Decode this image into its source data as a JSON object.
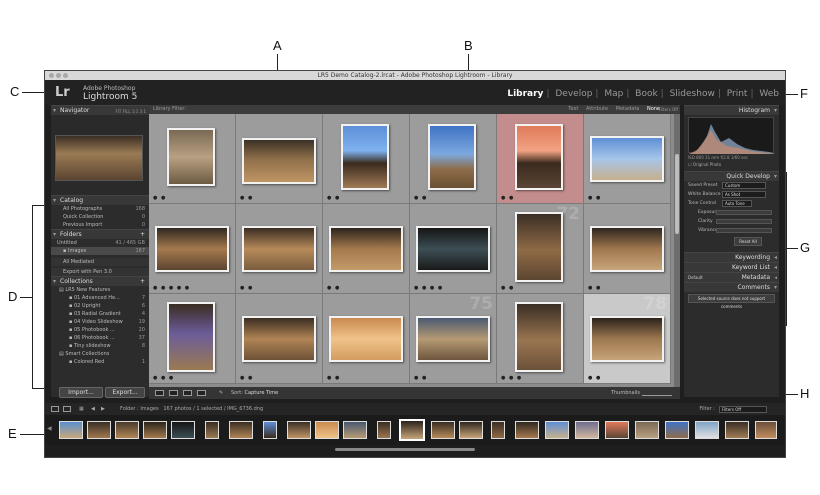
{
  "window": {
    "title": "LR5 Demo Catalog-2.lrcat - Adobe Photoshop Lightroom - Library"
  },
  "identity": {
    "logo": "Lr",
    "product": "Adobe Photoshop",
    "version": "Lightroom 5"
  },
  "modules": [
    "Library",
    "Develop",
    "Map",
    "Book",
    "Slideshow",
    "Print",
    "Web"
  ],
  "active_module": "Library",
  "callouts": {
    "A": "A",
    "B": "B",
    "C": "C",
    "D": "D",
    "E": "E",
    "F": "F",
    "G": "G",
    "H": "H"
  },
  "left_panel": {
    "navigator": {
      "title": "Navigator",
      "zoom": "FIT  FILL  1:1  3:1"
    },
    "catalog": {
      "title": "Catalog",
      "items": [
        {
          "label": "All Photographs",
          "count": "168"
        },
        {
          "label": "Quick Collection",
          "count": "0"
        },
        {
          "label": "Previous Import",
          "count": "0"
        }
      ]
    },
    "folders": {
      "title": "Folders",
      "volume": {
        "label": "Untitled",
        "count": "41 / 465 GB"
      },
      "items": [
        {
          "label": "Images",
          "count": "167"
        }
      ]
    },
    "sub_panels": [
      "All Mediated",
      "Export with Pen 3.0"
    ],
    "collections": {
      "title": "Collections",
      "items": [
        {
          "label": "LR5 New Features",
          "count": ""
        },
        {
          "label": "01 Advanced He...",
          "count": "7"
        },
        {
          "label": "02 Upright",
          "count": "6"
        },
        {
          "label": "03 Radial Gradient",
          "count": "4"
        },
        {
          "label": "04 Video Slideshow",
          "count": "19"
        },
        {
          "label": "05 Photobook ...",
          "count": "20"
        },
        {
          "label": "06 Photobook ...",
          "count": "37"
        },
        {
          "label": "Tiny slideshow",
          "count": "8"
        },
        {
          "label": "Smart Collections",
          "count": ""
        },
        {
          "label": "Colored Red",
          "count": "1"
        }
      ]
    },
    "import_label": "Import...",
    "export_label": "Export..."
  },
  "center": {
    "filter_title": "Library Filter:",
    "filter_options": [
      "Text",
      "Attribute",
      "Metadata",
      "None"
    ],
    "filter_active": "None",
    "filter_status": "Filters Off",
    "cells": [
      {
        "num": "",
        "stars": "● ●"
      },
      {
        "num": "",
        "stars": "● ●"
      },
      {
        "num": "",
        "stars": "● ●"
      },
      {
        "num": "",
        "stars": "● ●"
      },
      {
        "num": "",
        "stars": "● ●"
      },
      {
        "num": "",
        "stars": "● ●"
      },
      {
        "num": "",
        "stars": "● ● ● ● ●"
      },
      {
        "num": "",
        "stars": "● ●"
      },
      {
        "num": "",
        "stars": "● ●"
      },
      {
        "num": "",
        "stars": "● ● ● ●"
      },
      {
        "num": "72",
        "stars": "● ●"
      },
      {
        "num": "",
        "stars": "● ●"
      },
      {
        "num": "",
        "stars": "● ● ●"
      },
      {
        "num": "",
        "stars": "● ●"
      },
      {
        "num": "",
        "stars": "● ●"
      },
      {
        "num": "75",
        "stars": "● ●"
      },
      {
        "num": "",
        "stars": "● ● ●"
      },
      {
        "num": "78",
        "stars": "● ●"
      }
    ]
  },
  "toolbar": {
    "sort_label": "Sort:",
    "sort_value": "Capture Time",
    "thumbnails_label": "Thumbnails"
  },
  "right_panel": {
    "histogram_title": "Histogram",
    "histo_info": "ISO 800   31 mm   f/2.8   1/60 sec",
    "original_photo": "Original Photo",
    "quick_develop": {
      "title": "Quick Develop",
      "saved_preset": {
        "label": "Saved Preset",
        "value": "Custom"
      },
      "white_balance": {
        "label": "White Balance",
        "value": "As Shot"
      },
      "tone_control": {
        "label": "Tone Control",
        "value": "Auto Tone"
      },
      "exposure": "Exposure",
      "clarity": "Clarity",
      "vibrance": "Vibrance",
      "reset": "Reset All"
    },
    "keywording": "Keywording",
    "keyword_list": "Keyword List",
    "metadata": {
      "title": "Metadata",
      "preset": "Default"
    },
    "comments": "Comments",
    "sync_note": "Selected source does not support comments"
  },
  "filmstrip": {
    "folder_label": "Folder : Images",
    "info": "167 photos / 1 selected / IMG_6736.dng",
    "filter_label": "Filter :",
    "filter_value": "Filters Off"
  }
}
